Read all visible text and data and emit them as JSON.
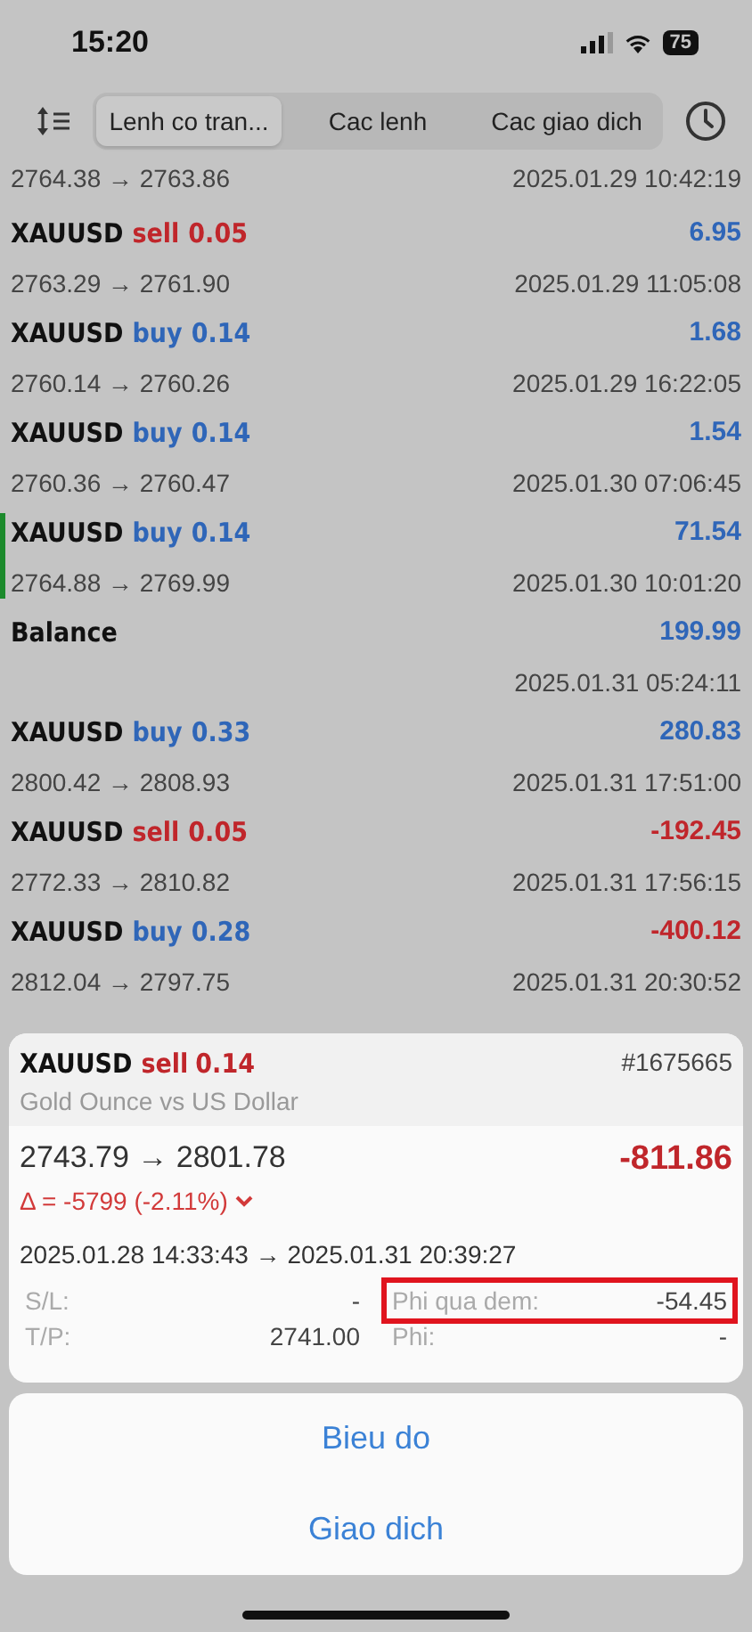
{
  "status_bar": {
    "time": "15:20",
    "battery": "75"
  },
  "toolbar": {
    "tabs": [
      {
        "label": "Lenh co tran...",
        "selected": true
      },
      {
        "label": "Cac lenh",
        "selected": false
      },
      {
        "label": "Cac giao dich",
        "selected": false
      }
    ]
  },
  "history": [
    {
      "kind": "partial",
      "prices": "2764.38 → 2763.86",
      "time": "2025.01.29 10:42:19"
    },
    {
      "kind": "trade",
      "symbol": "XAUUSD",
      "side": "sell",
      "volume": "0.05",
      "profit": "6.95",
      "prices": "2763.29 → 2761.90",
      "time": "2025.01.29 11:05:08",
      "selected": false
    },
    {
      "kind": "trade",
      "symbol": "XAUUSD",
      "side": "buy",
      "volume": "0.14",
      "profit": "1.68",
      "prices": "2760.14 → 2760.26",
      "time": "2025.01.29 16:22:05",
      "selected": false
    },
    {
      "kind": "trade",
      "symbol": "XAUUSD",
      "side": "buy",
      "volume": "0.14",
      "profit": "1.54",
      "prices": "2760.36 → 2760.47",
      "time": "2025.01.30 07:06:45",
      "selected": false
    },
    {
      "kind": "trade",
      "symbol": "XAUUSD",
      "side": "buy",
      "volume": "0.14",
      "profit": "71.54",
      "prices": "2764.88 → 2769.99",
      "time": "2025.01.30 10:01:20",
      "selected": true
    },
    {
      "kind": "balance",
      "symbol": "Balance",
      "profit": "199.99",
      "time": "2025.01.31 05:24:11",
      "selected": false
    },
    {
      "kind": "trade",
      "symbol": "XAUUSD",
      "side": "buy",
      "volume": "0.33",
      "profit": "280.83",
      "prices": "2800.42 → 2808.93",
      "time": "2025.01.31 17:51:00",
      "selected": false
    },
    {
      "kind": "trade",
      "symbol": "XAUUSD",
      "side": "sell",
      "volume": "0.05",
      "profit": "-192.45",
      "prices": "2772.33 → 2810.82",
      "time": "2025.01.31 17:56:15",
      "selected": false
    },
    {
      "kind": "trade",
      "symbol": "XAUUSD",
      "side": "buy",
      "volume": "0.28",
      "profit": "-400.12",
      "prices": "2812.04 → 2797.75",
      "time": "2025.01.31 20:30:52",
      "selected": false
    }
  ],
  "detail": {
    "symbol": "XAUUSD",
    "side": "sell",
    "volume": "0.14",
    "ticket": "#1675665",
    "description": "Gold Ounce vs US Dollar",
    "prices": "2743.79 → 2801.78",
    "profit": "-811.86",
    "delta": "Δ = -5799 (-2.11%)",
    "times": "2025.01.28 14:33:43 → 2025.01.31 20:39:27",
    "fields": [
      {
        "label": "S/L:",
        "value": "-",
        "highlighted": false
      },
      {
        "label": "Phi qua dem:",
        "value": "-54.45",
        "highlighted": true
      },
      {
        "label": "T/P:",
        "value": "2741.00",
        "highlighted": false
      },
      {
        "label": "Phi:",
        "value": "-",
        "highlighted": false
      }
    ]
  },
  "actions": [
    "Bieu do",
    "Giao dich"
  ]
}
